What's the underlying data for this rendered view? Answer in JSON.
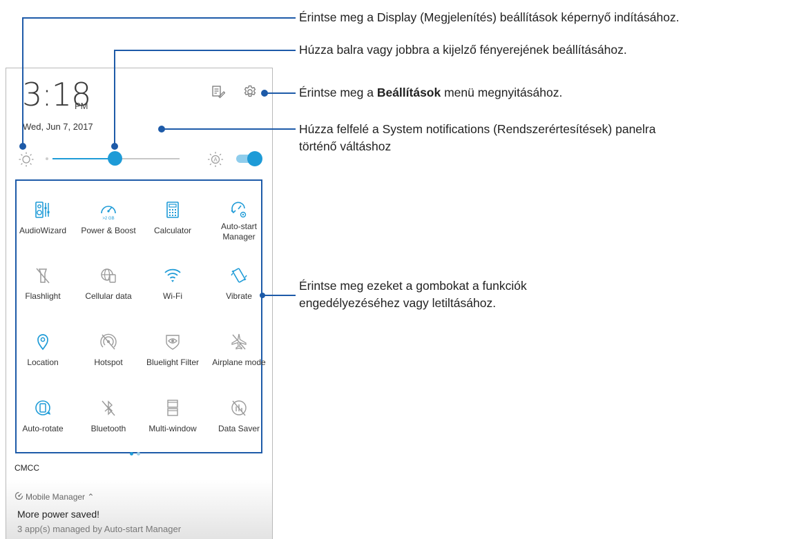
{
  "status": {
    "time": "3:18",
    "ampm": "PM",
    "date": "Wed, Jun 7, 2017",
    "notes_icon": "notes-edit-icon",
    "settings_icon": "gear-icon"
  },
  "brightness": {
    "level": 0.49,
    "auto_enabled": true,
    "left_icon": "brightness-low-icon",
    "auto_icon": "brightness-auto-icon"
  },
  "tiles": [
    {
      "label": "AudioWizard",
      "icon": "audiowizard-icon",
      "active": true
    },
    {
      "label": "Power & Boost",
      "icon": "speedometer-icon",
      "active": true,
      "sublabel": ">2 GB"
    },
    {
      "label": "Calculator",
      "icon": "calculator-icon",
      "active": true
    },
    {
      "label": "Auto-start",
      "label2": "Manager",
      "icon": "autostart-icon",
      "active": true
    },
    {
      "label": "Flashlight",
      "icon": "flashlight-off-icon",
      "active": false
    },
    {
      "label": "Cellular data",
      "icon": "globe-sim-icon",
      "active": false
    },
    {
      "label": "Wi-Fi",
      "icon": "wifi-icon",
      "active": true
    },
    {
      "label": "Vibrate",
      "icon": "vibrate-icon",
      "active": true
    },
    {
      "label": "Location",
      "icon": "location-pin-icon",
      "active": true
    },
    {
      "label": "Hotspot",
      "icon": "hotspot-off-icon",
      "active": false
    },
    {
      "label": "Bluelight Filter",
      "icon": "eye-shield-icon",
      "active": false
    },
    {
      "label": "Airplane mode",
      "icon": "airplane-off-icon",
      "active": false
    },
    {
      "label": "Auto-rotate",
      "icon": "auto-rotate-icon",
      "active": true
    },
    {
      "label": "Bluetooth",
      "icon": "bluetooth-off-icon",
      "active": false
    },
    {
      "label": "Multi-window",
      "icon": "multiwindow-icon",
      "active": false
    },
    {
      "label": "Data Saver",
      "icon": "datasaver-off-icon",
      "active": false
    }
  ],
  "carrier": "CMCC",
  "notification": {
    "app": "Mobile Manager",
    "title": "More power saved!",
    "text": "3 app(s) managed by Auto-start Manager"
  },
  "callouts": {
    "display": "Érintse meg a Display (Megjelenítés) beállítások képernyő indításához.",
    "brightness": "Húzza balra vagy jobbra a kijelző fényerejének beállításához.",
    "settings_pre": "Érintse meg a ",
    "settings_bold": "Beállítások",
    "settings_post": " menü megnyitásához.",
    "system_line1": "Húzza felfelé a System notifications (Rendszerértesítések) panelra",
    "system_line2": "történő váltáshoz",
    "buttons_line1": "Érintse meg ezeket a gombokat a funkciók",
    "buttons_line2": "engedélyezéséhez vagy letiltásához."
  },
  "colors": {
    "accent": "#1e9bd7",
    "callout_line": "#1d5aa8",
    "inactive_icon": "#9a9a9a"
  }
}
